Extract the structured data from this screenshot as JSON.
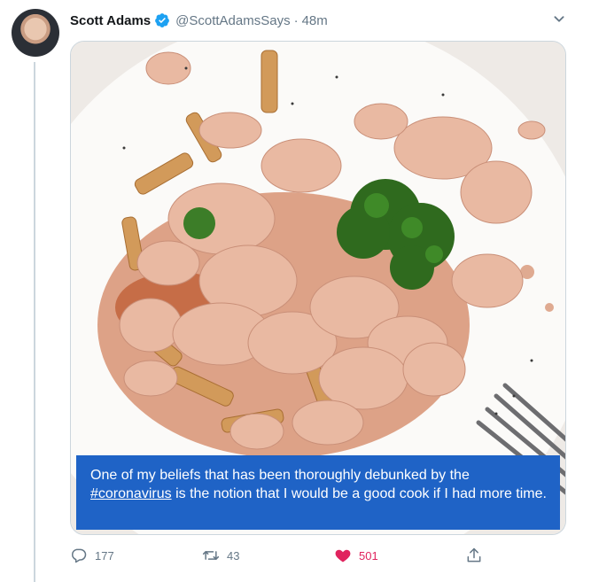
{
  "tweet": {
    "author_name": "Scott Adams",
    "handle": "@ScottAdamsSays",
    "separator": "·",
    "time": "48m",
    "caption_prefix": "One of my beliefs that has been thoroughly debunked by the",
    "hashtag": "#coronavirus",
    "caption_suffix": "is the notion that I would be a good cook if I had more time.",
    "reply_count": "177",
    "retweet_count": "43",
    "like_count": "501"
  },
  "icons": {
    "verified": "verified-badge-icon",
    "caret": "chevron-down-icon",
    "reply": "reply-icon",
    "retweet": "retweet-icon",
    "like": "heart-icon",
    "share": "share-icon"
  },
  "colors": {
    "verified": "#1da1f2",
    "like": "#e0245e",
    "caption_background": "#1f63c6",
    "muted": "#657786"
  }
}
